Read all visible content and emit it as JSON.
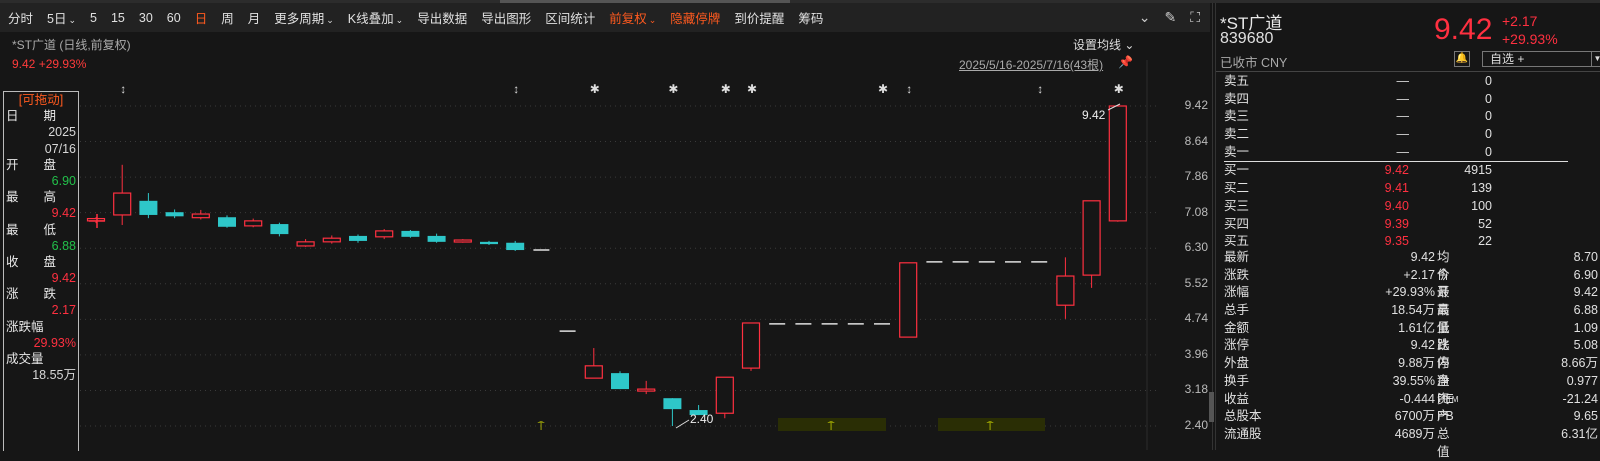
{
  "toolbar": {
    "items": [
      {
        "label": "分时"
      },
      {
        "label": "5日",
        "dropdown": true
      },
      {
        "label": "5"
      },
      {
        "label": "15"
      },
      {
        "label": "30"
      },
      {
        "label": "60"
      },
      {
        "label": "日",
        "active": true
      },
      {
        "label": "周"
      },
      {
        "label": "月"
      },
      {
        "label": "更多周期",
        "dropdown": true
      },
      {
        "label": "K线叠加",
        "dropdown": true
      },
      {
        "label": "导出数据"
      },
      {
        "label": "导出图形"
      },
      {
        "label": "区间统计"
      },
      {
        "label": "前复权",
        "dropdown": true,
        "active": true
      },
      {
        "label": "隐藏停牌",
        "active": true
      },
      {
        "label": "到价提醒"
      },
      {
        "label": "筹码"
      }
    ],
    "icons": [
      "chevron-circle-icon",
      "brush-icon",
      "fullscreen-icon"
    ]
  },
  "chart_header": {
    "title": "*ST广道 (日线,前复权)",
    "price_line": "9.42 +29.93%",
    "set_ma": "设置均线",
    "range": "2025/5/16-2025/7/16(43根)"
  },
  "infobox": {
    "header": "[可拖动]",
    "rows": [
      {
        "k": "日　　期",
        "v": [
          "2025",
          "07/16"
        ],
        "c": ""
      },
      {
        "k": "开　　盘",
        "v": [
          "6.90"
        ],
        "c": "green"
      },
      {
        "k": "最　　高",
        "v": [
          "9.42"
        ],
        "c": "red"
      },
      {
        "k": "最　　低",
        "v": [
          "6.88"
        ],
        "c": "green"
      },
      {
        "k": "收　　盘",
        "v": [
          "9.42"
        ],
        "c": "red"
      },
      {
        "k": "涨　　跌",
        "v": [
          "2.17"
        ],
        "c": "red"
      },
      {
        "k": "涨跌幅",
        "v": [
          "29.93%"
        ],
        "c": "red"
      },
      {
        "k": "成交量",
        "v": [
          "18.55万"
        ],
        "c": ""
      }
    ]
  },
  "chart_data": {
    "type": "candlestick",
    "y_ticks": [
      "9.42",
      "8.64",
      "7.86",
      "7.08",
      "6.30",
      "5.52",
      "4.74",
      "3.96",
      "3.18",
      "2.40"
    ],
    "ylim": [
      2.4,
      9.42
    ],
    "colors": {
      "up": "#ff3040",
      "down": "#2ec7c9",
      "flat": "#e0e0e0"
    },
    "annotations": {
      "high_label": "9.42",
      "low_label": "2.40"
    },
    "candles": [
      [
        6.9,
        6.98,
        6.85,
        6.95
      ],
      [
        7.03,
        8.13,
        6.81,
        7.51
      ],
      [
        7.34,
        7.51,
        6.96,
        7.03
      ],
      [
        7.09,
        7.15,
        6.96,
        7.0
      ],
      [
        6.97,
        7.14,
        6.93,
        7.05
      ],
      [
        6.98,
        7.02,
        6.75,
        6.77
      ],
      [
        6.79,
        6.95,
        6.76,
        6.9
      ],
      [
        6.83,
        6.86,
        6.56,
        6.61
      ],
      [
        6.35,
        6.5,
        6.33,
        6.44
      ],
      [
        6.44,
        6.58,
        6.4,
        6.52
      ],
      [
        6.57,
        6.6,
        6.42,
        6.46
      ],
      [
        6.55,
        6.72,
        6.5,
        6.68
      ],
      [
        6.68,
        6.7,
        6.53,
        6.55
      ],
      [
        6.57,
        6.62,
        6.42,
        6.44
      ],
      [
        6.44,
        6.5,
        6.42,
        6.48
      ],
      [
        6.44,
        6.46,
        6.37,
        6.39
      ],
      [
        6.42,
        6.46,
        6.24,
        6.26
      ],
      [
        6.26,
        6.26,
        6.26,
        6.26
      ],
      [
        4.48,
        4.48,
        4.48,
        4.48
      ],
      [
        3.45,
        4.11,
        3.45,
        3.72
      ],
      [
        3.56,
        3.6,
        3.21,
        3.21
      ],
      [
        3.17,
        3.39,
        3.1,
        3.21
      ],
      [
        3.01,
        3.01,
        2.4,
        2.77
      ],
      [
        2.75,
        2.86,
        2.64,
        2.64
      ],
      [
        2.68,
        3.47,
        2.57,
        3.47
      ],
      [
        3.67,
        4.66,
        3.61,
        4.66
      ],
      [
        4.64,
        4.64,
        4.64,
        4.64
      ],
      [
        4.64,
        4.64,
        4.64,
        4.64
      ],
      [
        4.64,
        4.64,
        4.64,
        4.64
      ],
      [
        4.64,
        4.64,
        4.64,
        4.64
      ],
      [
        4.64,
        4.64,
        4.64,
        4.64
      ],
      [
        4.35,
        5.98,
        4.35,
        5.98
      ],
      [
        6.0,
        6.0,
        6.0,
        6.0
      ],
      [
        6.0,
        6.0,
        6.0,
        6.0
      ],
      [
        6.0,
        6.0,
        6.0,
        6.0
      ],
      [
        6.0,
        6.0,
        6.0,
        6.0
      ],
      [
        6.0,
        6.0,
        6.0,
        6.0
      ],
      [
        5.05,
        6.1,
        4.75,
        5.69
      ],
      [
        5.71,
        7.34,
        5.43,
        7.34
      ],
      [
        6.9,
        9.42,
        6.88,
        9.42
      ]
    ],
    "event_markers": [
      {
        "bar": 2,
        "type": "arrows"
      },
      {
        "bar": 17,
        "type": "arrows"
      },
      {
        "bar": 20,
        "type": "star"
      },
      {
        "bar": 23,
        "type": "star"
      },
      {
        "bar": 25,
        "type": "star"
      },
      {
        "bar": 26,
        "type": "star"
      },
      {
        "bar": 31,
        "type": "star"
      },
      {
        "bar": 32,
        "type": "arrows"
      },
      {
        "bar": 37,
        "type": "arrows"
      },
      {
        "bar": 40,
        "type": "star"
      }
    ]
  },
  "quote": {
    "name": "*ST广道",
    "code": "839680",
    "status": "已收市 CNY",
    "price": "9.42",
    "change": "+2.17",
    "pct": "+29.93%",
    "watch_label": "自选 +"
  },
  "orderbook": {
    "asks": [
      {
        "l": "卖五",
        "p": "—",
        "q": "0"
      },
      {
        "l": "卖四",
        "p": "—",
        "q": "0"
      },
      {
        "l": "卖三",
        "p": "—",
        "q": "0"
      },
      {
        "l": "卖二",
        "p": "—",
        "q": "0"
      },
      {
        "l": "卖一",
        "p": "—",
        "q": "0"
      }
    ],
    "bids": [
      {
        "l": "买一",
        "p": "9.42",
        "q": "4915"
      },
      {
        "l": "买二",
        "p": "9.41",
        "q": "139"
      },
      {
        "l": "买三",
        "p": "9.40",
        "q": "100"
      },
      {
        "l": "买四",
        "p": "9.39",
        "q": "52"
      },
      {
        "l": "买五",
        "p": "9.35",
        "q": "22"
      }
    ]
  },
  "stats": [
    {
      "k1": "最新",
      "v1": "9.42",
      "c1": "red",
      "k2": "均价",
      "v2": "8.70",
      "c2": "red"
    },
    {
      "k1": "涨跌",
      "v1": "+2.17",
      "c1": "red",
      "k2": "今开",
      "v2": "6.90",
      "c2": "green"
    },
    {
      "k1": "涨幅",
      "v1": "+29.93%",
      "c1": "red",
      "k2": "最高",
      "v2": "9.42",
      "c2": "red"
    },
    {
      "k1": "总手",
      "v1": "18.54万",
      "c1": "",
      "k2": "最低",
      "v2": "6.88",
      "c2": "green"
    },
    {
      "k1": "金额",
      "v1": "1.61亿",
      "c1": "cyan",
      "k2": "量比",
      "v2": "1.09",
      "c2": ""
    },
    {
      "k1": "涨停",
      "v1": "9.42",
      "c1": "red",
      "k2": "跌停",
      "v2": "5.08",
      "c2": "green"
    },
    {
      "k1": "外盘",
      "v1": "9.88万",
      "c1": "red",
      "k2": "内盘",
      "v2": "8.66万",
      "c2": "green"
    },
    {
      "k1": "换手",
      "v1": "39.55%",
      "c1": "",
      "k2": "净资产",
      "v2": "0.977",
      "c2": ""
    },
    {
      "k1": "收益",
      "v1": "-0.444",
      "c1": "",
      "k2": "PE",
      "k2sup": "TTM",
      "v2": "-21.24",
      "c2": ""
    },
    {
      "k1": "总股本",
      "v1": "6700万",
      "c1": "",
      "k2": "PB",
      "v2": "9.65",
      "c2": ""
    },
    {
      "k1": "流通股",
      "v1": "4689万",
      "c1": "",
      "k2": "总值",
      "v2": "6.31亿",
      "c2": ""
    }
  ]
}
